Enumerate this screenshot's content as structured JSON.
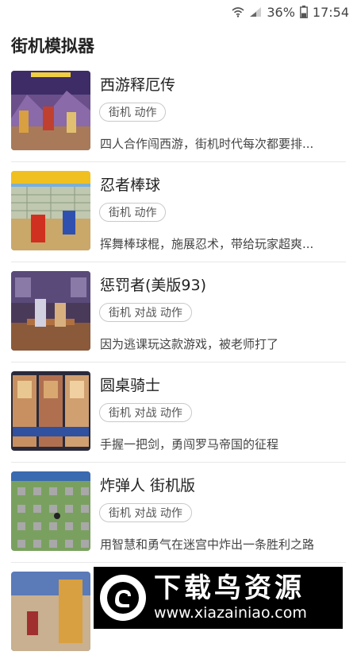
{
  "status_bar": {
    "icons": [
      "wifi-icon",
      "signal-icon",
      "battery-icon"
    ],
    "battery": "36%",
    "time": "17:54"
  },
  "header": {
    "title": "街机模拟器"
  },
  "games": [
    {
      "title": "西游释厄传",
      "tags": "街机 动作",
      "desc": "四人合作闯西游，街机时代每次都要排..."
    },
    {
      "title": "忍者棒球",
      "tags": "街机 动作",
      "desc": "挥舞棒球棍，施展忍术，带给玩家超爽..."
    },
    {
      "title": "惩罚者(美版93)",
      "tags": "街机 对战 动作",
      "desc": "因为逃课玩这款游戏，被老师打了"
    },
    {
      "title": "圆桌骑士",
      "tags": "街机 对战 动作",
      "desc": "手握一把剑，勇闯罗马帝国的征程"
    },
    {
      "title": "炸弹人 街机版",
      "tags": "街机 对战 动作",
      "desc": "用智慧和勇气在迷宫中炸出一条胜利之路"
    },
    {
      "title": "",
      "tags": "",
      "desc": ""
    }
  ],
  "watermark": {
    "title": "下载鸟资源",
    "url": "www.xiazainiao.com"
  }
}
